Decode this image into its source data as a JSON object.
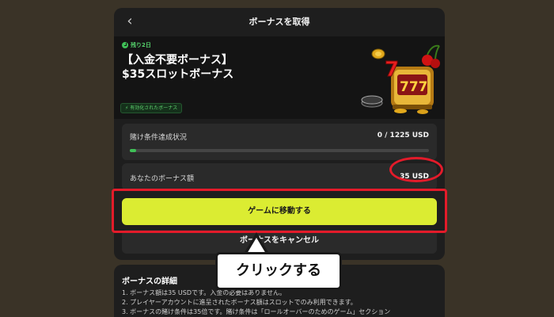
{
  "header": {
    "title": "ボーナスを取得",
    "back_icon": "chevron-left-icon"
  },
  "bonus": {
    "time_left": "残り2日",
    "title_line1": "【入金不要ボーナス】",
    "title_line2": "$35スロットボーナス",
    "status_badge": "有効化されたボーナス"
  },
  "wager": {
    "label": "賭け条件達成状況",
    "value": "0 / 1225 USD",
    "progress_fraction": 0.02
  },
  "amount": {
    "label": "あなたのボーナス額",
    "value": "35 USD"
  },
  "actions": {
    "go_label": "ゲームに移動する",
    "cancel_label": "ボーナスをキャンセル"
  },
  "details": {
    "title": "ボーナスの詳細",
    "items": [
      "1. ボーナス額は35 USDです。入金の必要はありません。",
      "2. プレイヤーアカウントに進呈されたボーナス額はスロットでのみ利用できます。",
      "3. ボーナスの賭け条件は35倍です。賭け条件は「ロールオーバーのためのゲーム」セクション"
    ]
  },
  "annotation": {
    "callout_text": "クリックする"
  },
  "colors": {
    "accent_yellow": "#dbec32",
    "highlight_red": "#e31b2a",
    "success_green": "#3fbf57"
  }
}
